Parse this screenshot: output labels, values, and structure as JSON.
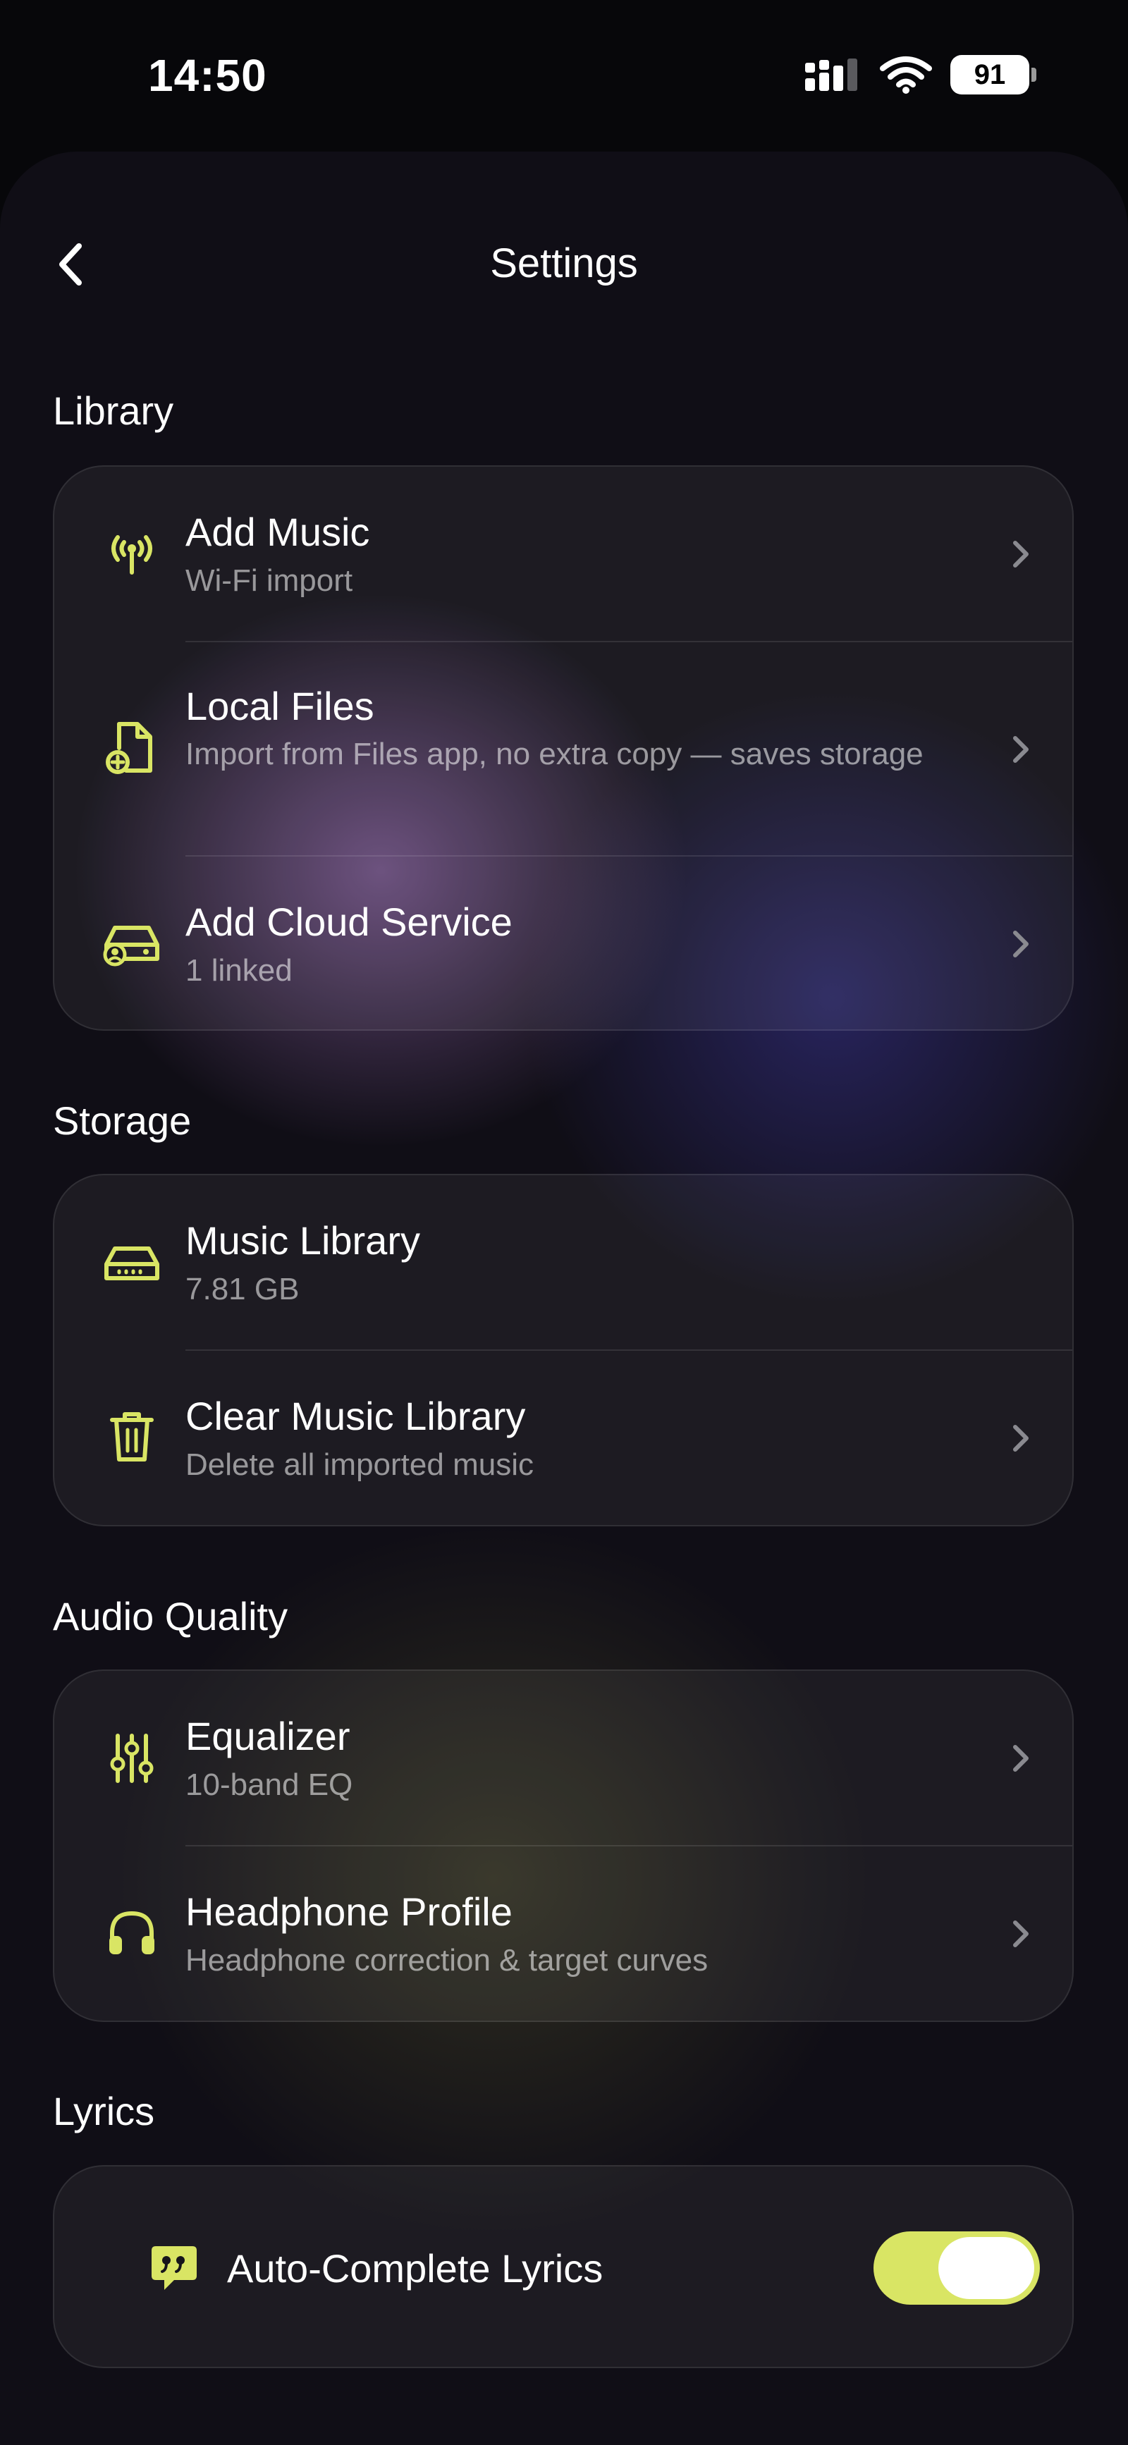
{
  "status_bar": {
    "time": "14:50",
    "battery": "91"
  },
  "nav": {
    "title": "Settings"
  },
  "sections": {
    "library": {
      "title": "Library",
      "items": [
        {
          "label": "Add Music",
          "sub": "Wi-Fi import",
          "icon": "broadcast-icon"
        },
        {
          "label": "Local Files",
          "sub": "Import from Files app, no extra copy — saves storage",
          "icon": "file-add-icon"
        },
        {
          "label": "Add Cloud Service",
          "sub": "1 linked",
          "icon": "cloud-drive-icon"
        }
      ]
    },
    "storage": {
      "title": "Storage",
      "items": [
        {
          "label": "Music Library",
          "sub": "7.81 GB",
          "icon": "hard-drive-icon"
        },
        {
          "label": "Clear Music Library",
          "sub": "Delete all imported music",
          "icon": "trash-icon"
        }
      ]
    },
    "audio_quality": {
      "title": "Audio Quality",
      "items": [
        {
          "label": "Equalizer",
          "sub": "10-band EQ",
          "icon": "sliders-icon"
        },
        {
          "label": "Headphone Profile",
          "sub": "Headphone correction & target curves",
          "icon": "headphones-icon"
        }
      ]
    },
    "lyrics": {
      "title": "Lyrics",
      "items": [
        {
          "label": "Auto-Complete Lyrics",
          "icon": "quote-bubble-icon",
          "toggle_on": true
        }
      ]
    }
  },
  "colors": {
    "accent": "#d9e564",
    "background": "#07070a",
    "chevron": "#8a8a90"
  }
}
